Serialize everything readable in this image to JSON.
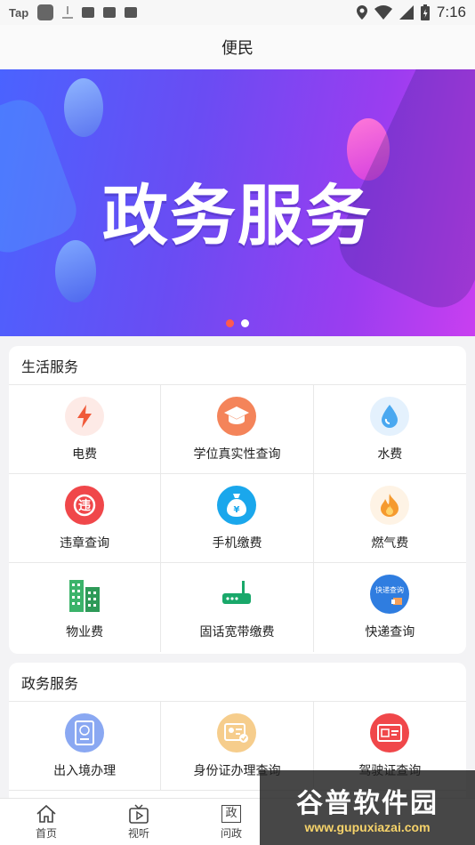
{
  "status_bar": {
    "app_label": "Tap",
    "time": "7:16"
  },
  "header": {
    "title": "便民"
  },
  "banner": {
    "title": "政务服务",
    "slides": 2,
    "active_slide": 1
  },
  "life_services": {
    "title": "生活服务",
    "items": [
      {
        "label": "电费",
        "icon": "lightning-icon",
        "color": "#f05a3a"
      },
      {
        "label": "学位真实性查询",
        "icon": "graduation-cap-icon",
        "color": "#f4845a"
      },
      {
        "label": "水费",
        "icon": "water-drop-icon",
        "color": "#4aa8f0"
      },
      {
        "label": "违章查询",
        "icon": "violation-icon",
        "color": "#f0474a"
      },
      {
        "label": "手机缴费",
        "icon": "money-bag-icon",
        "color": "#1aa7ec"
      },
      {
        "label": "燃气费",
        "icon": "flame-icon",
        "color": "#f59a2f"
      },
      {
        "label": "物业费",
        "icon": "building-icon",
        "color": "#3bb36a"
      },
      {
        "label": "固话宽带缴费",
        "icon": "router-icon",
        "color": "#19a86a"
      },
      {
        "label": "快递查询",
        "icon": "delivery-icon",
        "color": "#2f7de0",
        "badge": "快递查询"
      }
    ]
  },
  "gov_services": {
    "title": "政务服务",
    "items": [
      {
        "label": "出入境办理",
        "icon": "passport-icon",
        "color": "#7a9cf0"
      },
      {
        "label": "身份证办理查询",
        "icon": "id-card-icon",
        "color": "#f3c07a"
      },
      {
        "label": "驾驶证查询",
        "icon": "driver-license-icon",
        "color": "#f0474a"
      }
    ]
  },
  "bottom_nav": {
    "items": [
      {
        "label": "首页",
        "icon": "home-icon"
      },
      {
        "label": "视听",
        "icon": "tv-icon"
      },
      {
        "label": "问政",
        "icon": "gov-icon",
        "glyph": "政"
      }
    ]
  },
  "watermark": {
    "title": "谷普软件园",
    "url": "www.gupuxiazai.com"
  }
}
